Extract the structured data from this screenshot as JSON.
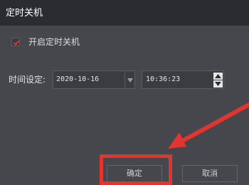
{
  "dialog": {
    "title": "定时关机",
    "enable_label": "开启定时关机",
    "enable_checked": true,
    "time_label": "时间设定:",
    "date_value": "2020-10-16",
    "time_value": "10:36:23",
    "ok_label": "确定",
    "cancel_label": "取消"
  },
  "colors": {
    "background": "#45474d",
    "titlebar": "#2b2c30",
    "checkmark": "#e3342f",
    "annotation": "#e3342f"
  },
  "icons": [
    "check-icon",
    "dropdown-arrow-icon",
    "spin-up-icon",
    "spin-down-icon",
    "annotation-arrow-icon"
  ]
}
